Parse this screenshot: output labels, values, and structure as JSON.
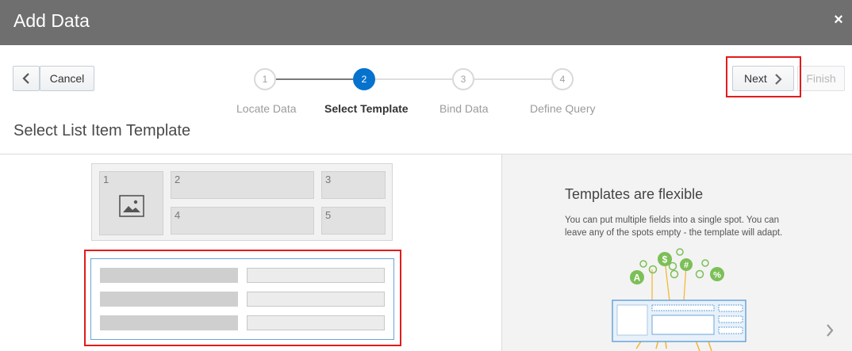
{
  "dialog": {
    "title": "Add Data",
    "close_glyph": "×"
  },
  "toolbar": {
    "cancel_label": "Cancel",
    "next_label": "Next",
    "finish_label": "Finish"
  },
  "train": {
    "steps": [
      {
        "number": "1",
        "label": "Locate Data",
        "state": "done"
      },
      {
        "number": "2",
        "label": "Select Template",
        "state": "active"
      },
      {
        "number": "3",
        "label": "Bind Data",
        "state": "pending"
      },
      {
        "number": "4",
        "label": "Define Query",
        "state": "pending"
      }
    ]
  },
  "section_title": "Select List Item Template",
  "templates": [
    {
      "slots": [
        "1",
        "2",
        "3",
        "4",
        "5"
      ],
      "selected": false
    },
    {
      "slots": [],
      "selected": true
    }
  ],
  "info": {
    "title": "Templates are flexible",
    "text": "You can put multiple fields into a single spot. You can leave any of the spots empty - the template will adapt."
  },
  "icons": {
    "back": "chevron-left-icon",
    "next": "chevron-right-icon",
    "close": "close-icon",
    "image": "image-placeholder-icon",
    "next_page": "chevron-right-icon"
  },
  "colors": {
    "accent": "#0572ce",
    "highlight": "#e31b1b",
    "titlebar": "#6f6f6f",
    "illustration_green": "#7cbf57",
    "illustration_blue": "#6aa4d8",
    "illustration_yellow": "#f3b52b"
  }
}
